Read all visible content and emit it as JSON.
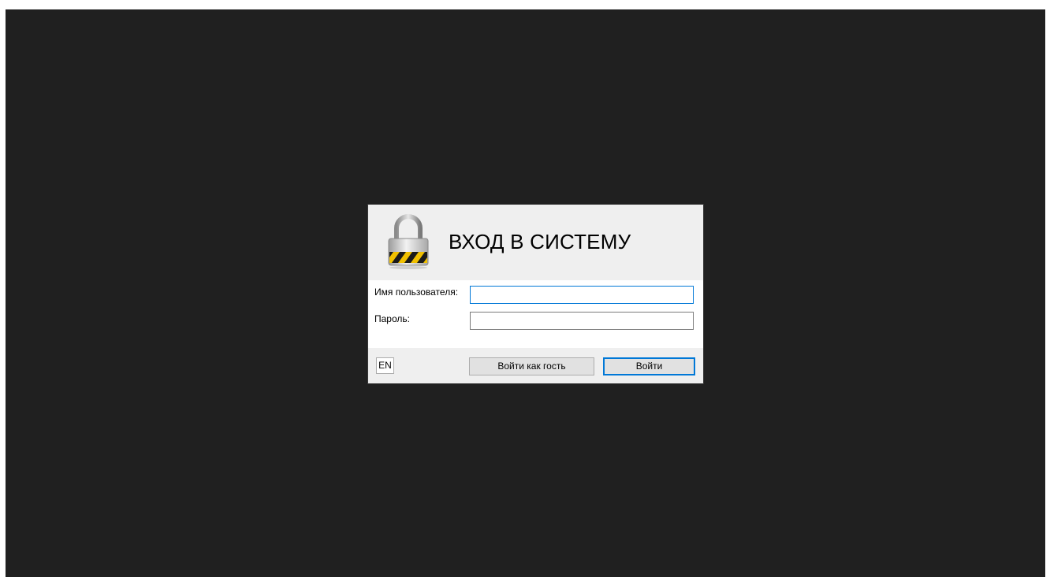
{
  "dialog": {
    "title": "ВХОД В СИСТЕМУ",
    "icon": "padlock-icon"
  },
  "form": {
    "username_label": "Имя пользователя:",
    "username_value": "",
    "password_label": "Пароль:",
    "password_value": ""
  },
  "footer": {
    "language_label": "EN",
    "guest_button_label": "Войти как гость",
    "login_button_label": "Войти"
  },
  "colors": {
    "background": "#202020",
    "panel": "#efefef",
    "focus_accent": "#0078d7",
    "warning_stripe": "#f0c000"
  }
}
